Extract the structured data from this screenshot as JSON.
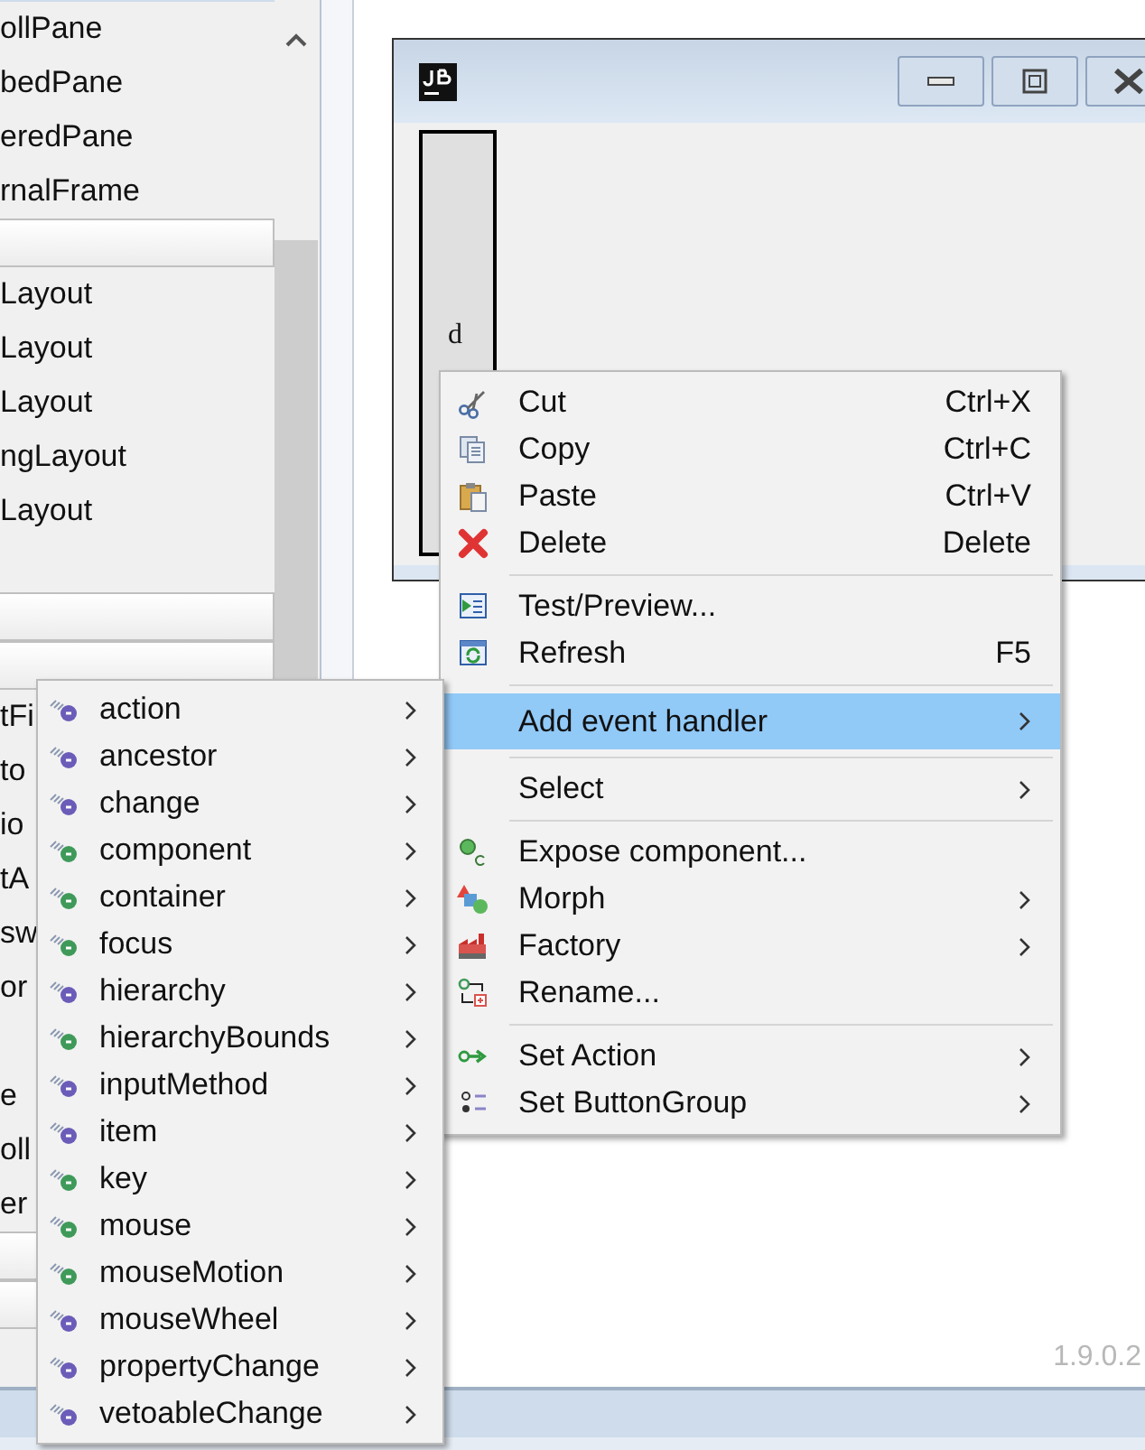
{
  "palette": {
    "items": [
      {
        "kind": "item",
        "label": "ollPane"
      },
      {
        "kind": "item",
        "label": "bedPane"
      },
      {
        "kind": "item",
        "label": "eredPane"
      },
      {
        "kind": "item",
        "label": "rnalFrame"
      },
      {
        "kind": "header"
      },
      {
        "kind": "item",
        "label": "Layout"
      },
      {
        "kind": "item",
        "label": "Layout"
      },
      {
        "kind": "item",
        "label": "Layout"
      },
      {
        "kind": "item",
        "label": "ngLayout"
      },
      {
        "kind": "item",
        "label": "Layout"
      },
      {
        "kind": "blank"
      },
      {
        "kind": "header"
      },
      {
        "kind": "header"
      },
      {
        "kind": "item",
        "label": "tFi"
      },
      {
        "kind": "item",
        "label": "to"
      },
      {
        "kind": "item",
        "label": "io"
      },
      {
        "kind": "item",
        "label": "tA"
      },
      {
        "kind": "item",
        "label": "sw"
      },
      {
        "kind": "item",
        "label": "or"
      },
      {
        "kind": "blank"
      },
      {
        "kind": "item",
        "label": "e"
      },
      {
        "kind": "item",
        "label": "oll"
      },
      {
        "kind": "item",
        "label": "er"
      },
      {
        "kind": "header"
      },
      {
        "kind": "header"
      }
    ]
  },
  "design_window": {
    "component_text": "d"
  },
  "version": "1.9.0.2",
  "context_menu": {
    "items": [
      {
        "kind": "item",
        "label": "Cut",
        "shortcut": "Ctrl+X",
        "selected": false,
        "submenu": false
      },
      {
        "kind": "item",
        "label": "Copy",
        "shortcut": "Ctrl+C",
        "selected": false,
        "submenu": false
      },
      {
        "kind": "item",
        "label": "Paste",
        "shortcut": "Ctrl+V",
        "selected": false,
        "submenu": false
      },
      {
        "kind": "item",
        "label": "Delete",
        "shortcut": "Delete",
        "selected": false,
        "submenu": false
      },
      {
        "kind": "separator"
      },
      {
        "kind": "item",
        "label": "Test/Preview...",
        "selected": false,
        "submenu": false
      },
      {
        "kind": "item",
        "label": "Refresh",
        "shortcut": "F5",
        "selected": false,
        "submenu": false
      },
      {
        "kind": "separator"
      },
      {
        "kind": "item",
        "label": "Add event handler",
        "selected": true,
        "submenu": true
      },
      {
        "kind": "separator"
      },
      {
        "kind": "item",
        "label": "Select",
        "selected": false,
        "submenu": true
      },
      {
        "kind": "separator"
      },
      {
        "kind": "item",
        "label": "Expose component...",
        "selected": false,
        "submenu": false
      },
      {
        "kind": "item",
        "label": "Morph",
        "selected": false,
        "submenu": true
      },
      {
        "kind": "item",
        "label": "Factory",
        "selected": false,
        "submenu": true
      },
      {
        "kind": "item",
        "label": "Rename...",
        "selected": false,
        "submenu": false
      },
      {
        "kind": "separator"
      },
      {
        "kind": "item",
        "label": "Set Action",
        "selected": false,
        "submenu": true
      },
      {
        "kind": "item",
        "label": "Set ButtonGroup",
        "selected": false,
        "submenu": true
      }
    ]
  },
  "event_submenu": {
    "items": [
      {
        "label": "action",
        "color": "#6a5cb8"
      },
      {
        "label": "ancestor",
        "color": "#6a5cb8"
      },
      {
        "label": "change",
        "color": "#6a5cb8"
      },
      {
        "label": "component",
        "color": "#3f9a5a"
      },
      {
        "label": "container",
        "color": "#3f9a5a"
      },
      {
        "label": "focus",
        "color": "#3f9a5a"
      },
      {
        "label": "hierarchy",
        "color": "#6a5cb8"
      },
      {
        "label": "hierarchyBounds",
        "color": "#3f9a5a"
      },
      {
        "label": "inputMethod",
        "color": "#6a5cb8"
      },
      {
        "label": "item",
        "color": "#6a5cb8"
      },
      {
        "label": "key",
        "color": "#3f9a5a"
      },
      {
        "label": "mouse",
        "color": "#3f9a5a"
      },
      {
        "label": "mouseMotion",
        "color": "#3f9a5a"
      },
      {
        "label": "mouseWheel",
        "color": "#6a5cb8"
      },
      {
        "label": "propertyChange",
        "color": "#6a5cb8"
      },
      {
        "label": "vetoableChange",
        "color": "#6a5cb8"
      }
    ]
  }
}
